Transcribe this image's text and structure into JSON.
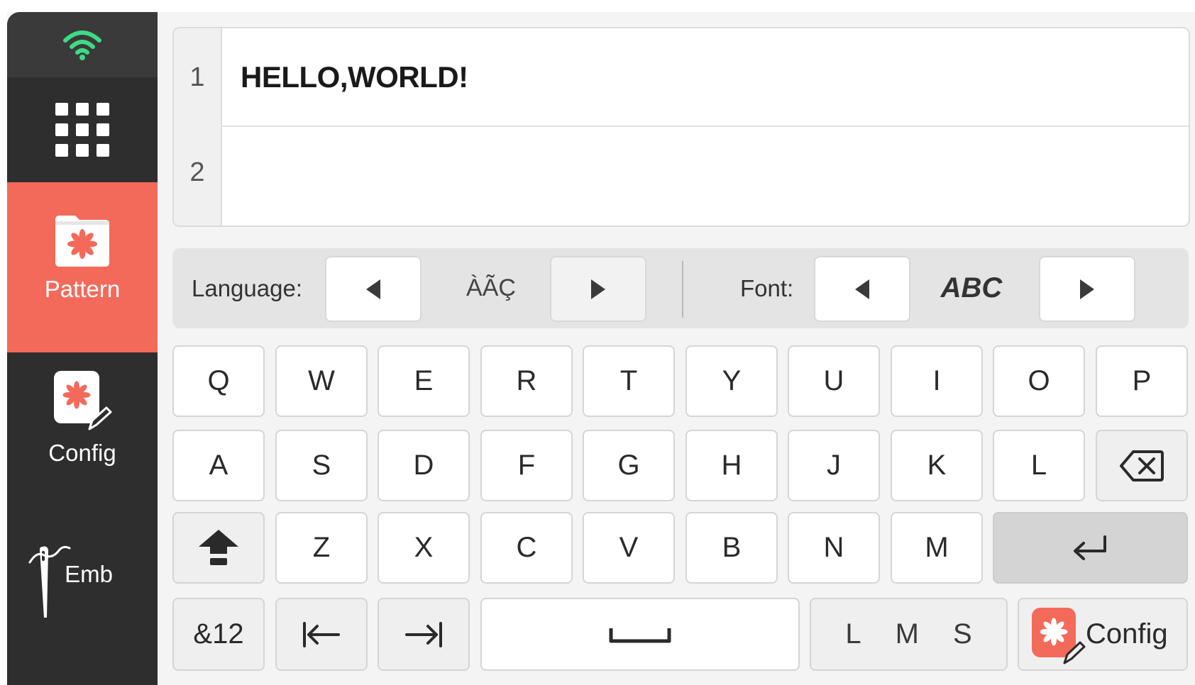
{
  "sidebar": {
    "wifi_icon": "wifi-icon",
    "apps_icon": "apps-grid-icon",
    "pattern_label": "Pattern",
    "config_label": "Config",
    "emb_label": "Emb",
    "active_item": "Pattern",
    "accent_color": "#f46a5a",
    "wifi_color": "#3ddc84"
  },
  "editor": {
    "lines": [
      {
        "number": "1",
        "text": "HELLO,WORLD!"
      },
      {
        "number": "2",
        "text": ""
      }
    ]
  },
  "options": {
    "language_label": "Language:",
    "language_value": "ÀÃÇ",
    "font_label": "Font:",
    "font_value": "ABC"
  },
  "keyboard": {
    "row1": [
      "Q",
      "W",
      "E",
      "R",
      "T",
      "Y",
      "U",
      "I",
      "O",
      "P"
    ],
    "row2": [
      "A",
      "S",
      "D",
      "F",
      "G",
      "H",
      "J",
      "K",
      "L"
    ],
    "row3": [
      "Z",
      "X",
      "C",
      "V",
      "B",
      "N",
      "M"
    ],
    "symbols_label": "&12",
    "sizes": [
      "L",
      "M",
      "S"
    ],
    "selected_size": "L",
    "config_label": "Config",
    "backspace_icon": "backspace-icon",
    "shift_icon": "shift-icon",
    "enter_icon": "enter-icon",
    "tab_left_icon": "tab-left-icon",
    "tab_right_icon": "tab-right-icon",
    "space_icon": "space-bar-icon"
  }
}
